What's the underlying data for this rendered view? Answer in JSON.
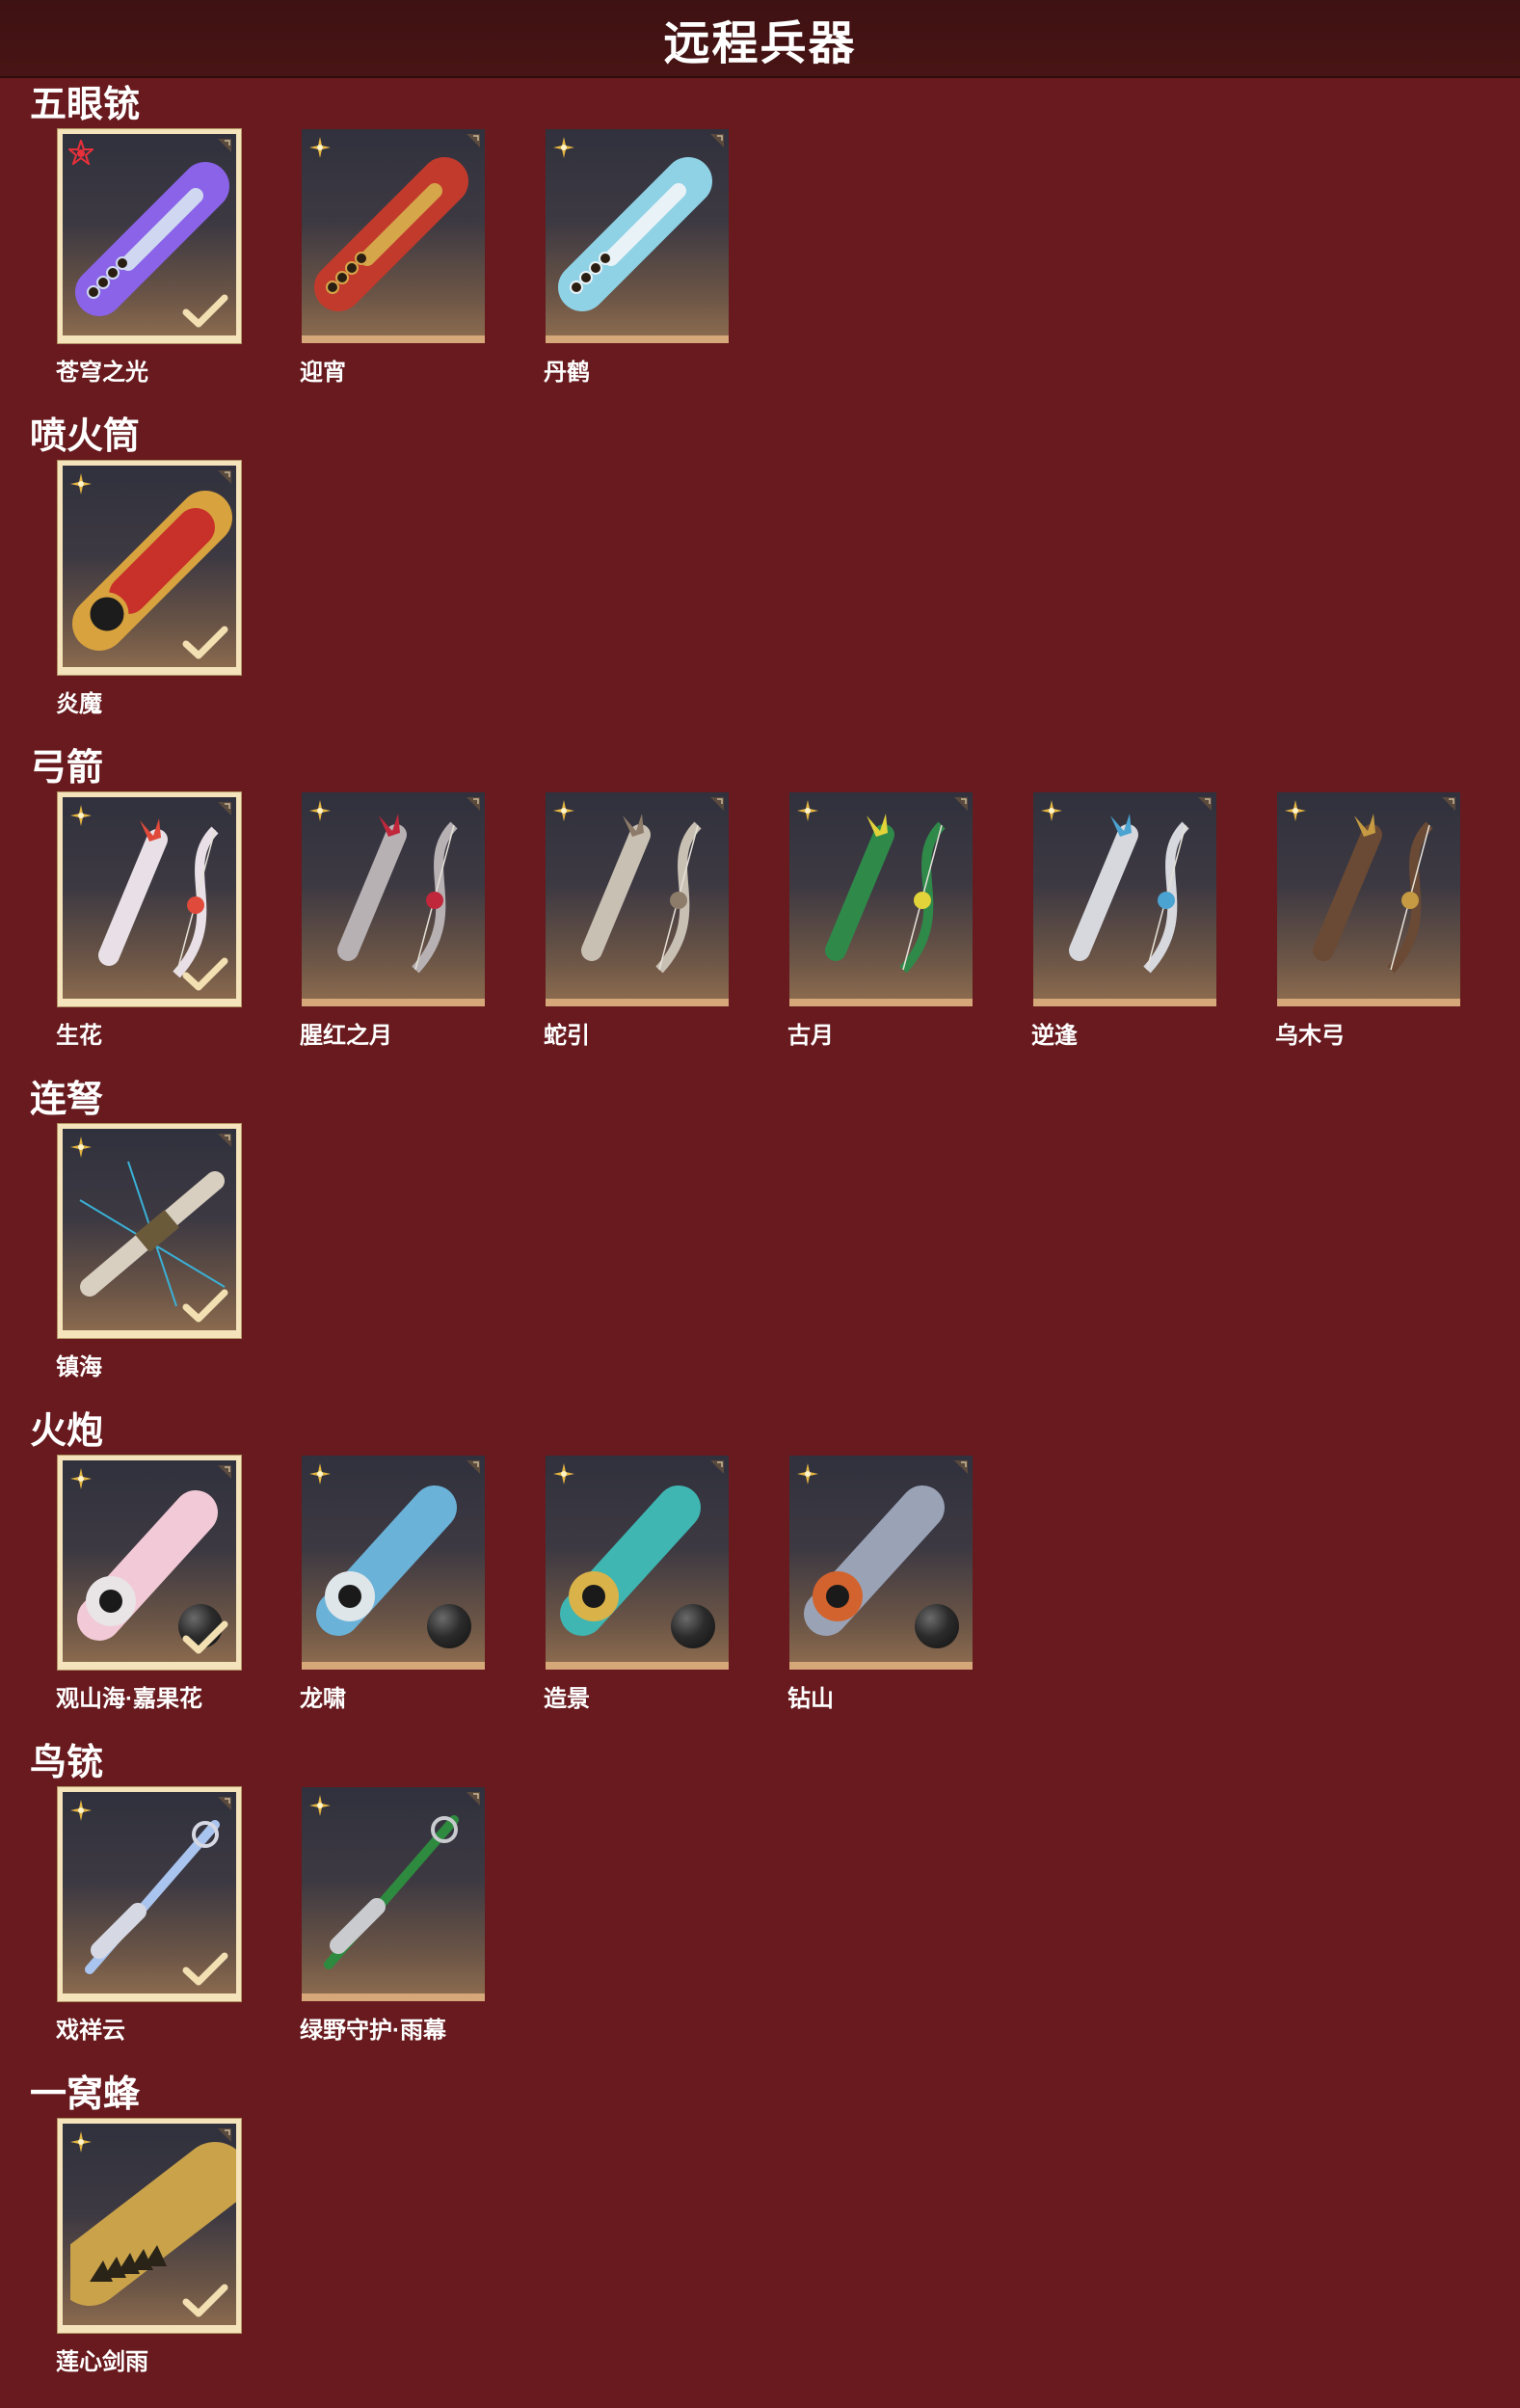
{
  "page": {
    "title": "远程兵器"
  },
  "sections": [
    {
      "title": "五眼铳",
      "items": [
        {
          "label": "苍穹之光",
          "selected": true,
          "rarity": "red-star-icon",
          "accent": "#8a63e8",
          "accent2": "#cfd8f0",
          "art": "gun-icon"
        },
        {
          "label": "迎宵",
          "selected": false,
          "rarity": "gold-star-icon",
          "accent": "#c23a2c",
          "accent2": "#d5a64a",
          "art": "gun-icon"
        },
        {
          "label": "丹鹤",
          "selected": false,
          "rarity": "gold-star-icon",
          "accent": "#8fd2e6",
          "accent2": "#e9f2f6",
          "art": "gun-icon"
        }
      ]
    },
    {
      "title": "喷火筒",
      "items": [
        {
          "label": "炎魔",
          "selected": true,
          "rarity": "gold-star-icon",
          "accent": "#c8302a",
          "accent2": "#d8a23e",
          "art": "flamethrower-icon"
        }
      ]
    },
    {
      "title": "弓箭",
      "items": [
        {
          "label": "生花",
          "selected": true,
          "rarity": "gold-star-icon",
          "accent": "#e8e0e6",
          "accent2": "#e04a3a",
          "art": "bow-icon"
        },
        {
          "label": "腥红之月",
          "selected": false,
          "rarity": "gold-star-icon",
          "accent": "#b7b1b4",
          "accent2": "#c0273a",
          "art": "bow-icon"
        },
        {
          "label": "蛇引",
          "selected": false,
          "rarity": "gold-star-icon",
          "accent": "#c9c0b4",
          "accent2": "#8e7c6a",
          "art": "bow-icon"
        },
        {
          "label": "古月",
          "selected": false,
          "rarity": "gold-star-icon",
          "accent": "#2f8a4a",
          "accent2": "#e2d33a",
          "art": "bow-icon"
        },
        {
          "label": "逆逢",
          "selected": false,
          "rarity": "gold-star-icon",
          "accent": "#d6d8de",
          "accent2": "#4ba3d1",
          "art": "bow-icon"
        },
        {
          "label": "乌木弓",
          "selected": false,
          "rarity": "gold-star-icon",
          "accent": "#6a4a34",
          "accent2": "#c59a42",
          "art": "bow-icon"
        }
      ]
    },
    {
      "title": "连弩",
      "items": [
        {
          "label": "镇海",
          "selected": true,
          "rarity": "gold-star-icon",
          "accent": "#d8cfc0",
          "accent2": "#3ab0d6",
          "art": "crossbow-icon"
        }
      ]
    },
    {
      "title": "火炮",
      "items": [
        {
          "label": "观山海·嘉果花",
          "selected": true,
          "rarity": "gold-star-icon",
          "accent": "#f2c9d6",
          "accent2": "#e9e4e6",
          "art": "cannon-icon",
          "ball": true
        },
        {
          "label": "龙啸",
          "selected": false,
          "rarity": "gold-star-icon",
          "accent": "#6bb2d8",
          "accent2": "#dfe6ea",
          "art": "cannon-icon",
          "ball": true
        },
        {
          "label": "造景",
          "selected": false,
          "rarity": "gold-star-icon",
          "accent": "#3fb6b2",
          "accent2": "#d9b24a",
          "art": "cannon-icon",
          "ball": true
        },
        {
          "label": "钻山",
          "selected": false,
          "rarity": "gold-star-icon",
          "accent": "#9aa2b6",
          "accent2": "#d2632e",
          "art": "cannon-icon",
          "ball": true
        }
      ]
    },
    {
      "title": "鸟铳",
      "items": [
        {
          "label": "戏祥云",
          "selected": true,
          "rarity": "gold-star-icon",
          "accent": "#a9c4ee",
          "accent2": "#d6d9e4",
          "art": "musket-icon"
        },
        {
          "label": "绿野守护·雨幕",
          "selected": false,
          "rarity": "gold-star-icon",
          "accent": "#2e8a3e",
          "accent2": "#c9cbcf",
          "art": "musket-icon"
        }
      ]
    },
    {
      "title": "一窝蜂",
      "items": [
        {
          "label": "莲心剑雨",
          "selected": true,
          "rarity": "gold-star-icon",
          "accent": "#c9a24a",
          "accent2": "#2a2418",
          "art": "rocket-launcher-icon"
        }
      ]
    }
  ]
}
